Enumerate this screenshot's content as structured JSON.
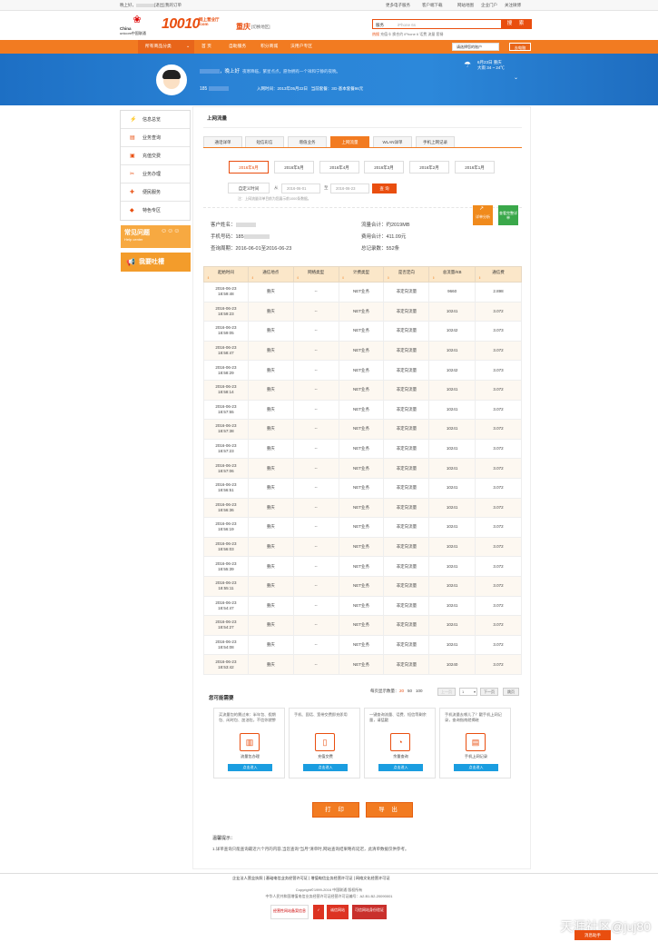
{
  "topbar": {
    "greeting": "晚上好，",
    "logout": "[退出]",
    "my_orders": "我的订单",
    "more_eservices": "更多电子服务",
    "client_download": "客户端下载",
    "site_map": "网站地图",
    "enterprise_portal": "企业门户",
    "follow_weibo": "关注微博"
  },
  "header": {
    "brand_cn": "China unicom中国联通",
    "brand_en": "China",
    "brand_en2": "unicom中国联通",
    "hotline": "10010",
    "hotline_sub": "网上营业厅",
    "hotline_domain": ".com",
    "city": "重庆",
    "city_switch": "[切换地区]",
    "search": {
      "scope": "服务",
      "placeholder": "iPhone 6s",
      "button": "搜 索"
    },
    "hot_label": "热搜",
    "hot_words": "充值卡  换合约  iPhone 6  话费  流量  套餐"
  },
  "nav": {
    "category": "所有商品分类",
    "items": [
      "首 页",
      "自助服务",
      "积分商城",
      "沃用户专区"
    ],
    "account_select": "请选择您的账户",
    "login_button": "去电脑"
  },
  "user": {
    "greeting": "，晚上好",
    "slogan": "夜寒降临，繁星点点，愿你拥有一个祥和宁静的夜晚。",
    "phone_prefix": "185",
    "join_date": "入网时间：2013年05月22日",
    "current_plan": "当前套餐：3G-基本套餐96元",
    "weather_date": "6月23日 重庆",
    "weather_desc": "大雨 34 ~ 24℃"
  },
  "sidebar": {
    "items": [
      {
        "label": "信息总览",
        "icon": "info-icon"
      },
      {
        "label": "业务查询",
        "icon": "query-icon"
      },
      {
        "label": "充值交费",
        "icon": "recharge-icon"
      },
      {
        "label": "业务办理",
        "icon": "handle-icon"
      },
      {
        "label": "便民服务",
        "icon": "service-icon"
      },
      {
        "label": "特色专区",
        "icon": "feature-icon"
      }
    ],
    "faq_title": "常见问题",
    "faq_sub": "Help center",
    "complain": "我要吐槽"
  },
  "page": {
    "title": "上网流量",
    "tabs": [
      "通话详单",
      "短信彩信",
      "增值业务",
      "上网流量",
      "WLAN详单",
      "手机上网记录"
    ],
    "active_tab": 3,
    "months": [
      "2016年6月",
      "2016年5月",
      "2016年4月",
      "2016年3月",
      "2016年2月",
      "2016年1月"
    ],
    "active_month": 0,
    "custom_time": "自定义时间",
    "from_label": "从",
    "from_date": "2016-06-01",
    "to_label": "至",
    "to_date": "2016-06-23",
    "query_button": "查 询",
    "note": "注：上网流量详单目前为您展示前1000条数据。",
    "customer_label": "客户姓名：",
    "phone_label": "手机号码：185",
    "period": "查询周期：2016-06-01至2016-06-23",
    "total_flow": "流量合计：约2019MB",
    "total_fee": "费用合计：411.09元",
    "total_count": "总记录数：552条",
    "badge_analysis": "详单分析",
    "badge_view": "查看完整详单"
  },
  "table": {
    "headers": [
      "起始时间",
      "通信地点",
      "网络类型",
      "计费类型",
      "是否定向",
      "总流量/KB",
      "通信费"
    ],
    "rows": [
      [
        "2016-06-23",
        "18:59:48",
        "重庆",
        "--",
        "NET业务",
        "非定向流量",
        "9660",
        "2.898"
      ],
      [
        "2016-06-23",
        "18:59:23",
        "重庆",
        "--",
        "NET业务",
        "非定向流量",
        "10241",
        "3.072"
      ],
      [
        "2016-06-23",
        "18:59:05",
        "重庆",
        "--",
        "NET业务",
        "非定向流量",
        "10242",
        "3.073"
      ],
      [
        "2016-06-23",
        "18:58:47",
        "重庆",
        "--",
        "NET业务",
        "非定向流量",
        "10241",
        "3.072"
      ],
      [
        "2016-06-23",
        "18:58:29",
        "重庆",
        "--",
        "NET业务",
        "非定向流量",
        "10242",
        "3.073"
      ],
      [
        "2016-06-23",
        "18:58:14",
        "重庆",
        "--",
        "NET业务",
        "非定向流量",
        "10241",
        "3.072"
      ],
      [
        "2016-06-23",
        "18:57:55",
        "重庆",
        "--",
        "NET业务",
        "非定向流量",
        "10241",
        "3.072"
      ],
      [
        "2016-06-23",
        "18:57:38",
        "重庆",
        "--",
        "NET业务",
        "非定向流量",
        "10241",
        "3.072"
      ],
      [
        "2016-06-23",
        "18:57:23",
        "重庆",
        "--",
        "NET业务",
        "非定向流量",
        "10241",
        "3.072"
      ],
      [
        "2016-06-23",
        "18:57:06",
        "重庆",
        "--",
        "NET业务",
        "非定向流量",
        "10241",
        "3.072"
      ],
      [
        "2016-06-23",
        "18:56:51",
        "重庆",
        "--",
        "NET业务",
        "非定向流量",
        "10241",
        "3.072"
      ],
      [
        "2016-06-23",
        "18:56:36",
        "重庆",
        "--",
        "NET业务",
        "非定向流量",
        "10241",
        "3.072"
      ],
      [
        "2016-06-23",
        "18:56:19",
        "重庆",
        "--",
        "NET业务",
        "非定向流量",
        "10241",
        "3.072"
      ],
      [
        "2016-06-23",
        "18:56:03",
        "重庆",
        "--",
        "NET业务",
        "非定向流量",
        "10241",
        "3.072"
      ],
      [
        "2016-06-23",
        "18:55:39",
        "重庆",
        "--",
        "NET业务",
        "非定向流量",
        "10241",
        "3.072"
      ],
      [
        "2016-06-23",
        "18:55:11",
        "重庆",
        "--",
        "NET业务",
        "非定向流量",
        "10241",
        "3.072"
      ],
      [
        "2016-06-23",
        "18:54:47",
        "重庆",
        "--",
        "NET业务",
        "非定向流量",
        "10241",
        "3.072"
      ],
      [
        "2016-06-23",
        "18:54:27",
        "重庆",
        "--",
        "NET业务",
        "非定向流量",
        "10241",
        "3.072"
      ],
      [
        "2016-06-23",
        "18:54:08",
        "重庆",
        "--",
        "NET业务",
        "非定向流量",
        "10241",
        "3.072"
      ],
      [
        "2016-06-23",
        "18:53:42",
        "重庆",
        "--",
        "NET业务",
        "非定向流量",
        "10240",
        "3.072"
      ]
    ]
  },
  "pager": {
    "per_page_label": "每页显示数量：",
    "sizes": [
      "20",
      "50",
      "100"
    ],
    "prev": "上一页",
    "page": "1",
    "next": "下一页",
    "jump": "跳页"
  },
  "needs": {
    "title": "您可能需要",
    "cards": [
      {
        "desc": "买流量包的需过来：半年包、假期包、闲时包、加油包，不信你就惨",
        "name": "流量包办理",
        "btn": "点击进入",
        "icon": "flow-package-icon"
      },
      {
        "desc": "手机、固话、宽带交费即充即用",
        "name": "充值交费",
        "btn": "点击进入",
        "icon": "recharge-card-icon"
      },
      {
        "desc": "一键查询流量、话费、短信等剩余量，请猛戳",
        "name": "余量查询",
        "btn": "点击进入",
        "icon": "balance-gauge-icon"
      },
      {
        "desc": "手机流量去哪儿了？戳手机上网记录，查询指南就揭晓",
        "name": "手机上网记录",
        "btn": "点击进入",
        "icon": "mobile-record-icon"
      }
    ]
  },
  "actions": {
    "print": "打 印",
    "export": "导 出"
  },
  "tips": {
    "title": "温馨提示：",
    "text": "1.详单查询只能查询最近六个月的内容,当您查询\"当月\"清单时,网站查询结果略有延迟，此清单数据仅供参考。"
  },
  "footer": {
    "links": "企业法人营业执照  |  基础电信业务经营许可证  |  增值电信业务经营许可证  |  网络文化经营许可证",
    "copyright": "Copyright©1999-2016  中国联通 版权所有",
    "icp": "中华人民共和国增值电信业务经营许可证经营许可证编号：A2.B1.B2-20090001",
    "badges": [
      "经营性网站备案信息",
      "诚信网站",
      "可信网站身份验证"
    ],
    "helper": "消息助手",
    "watermark": "天涯社区@juj80"
  }
}
